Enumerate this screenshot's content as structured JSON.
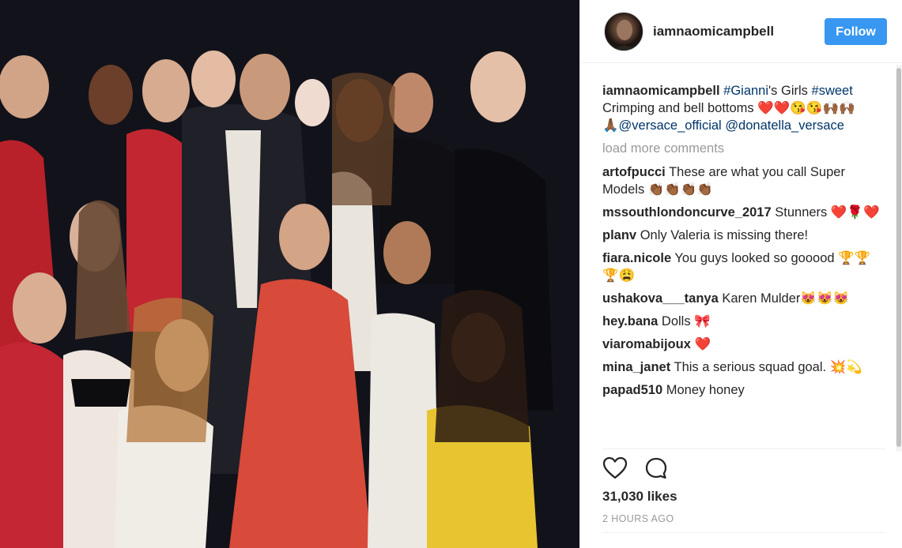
{
  "post": {
    "photo_alt": "Group photo",
    "author": "iamnaomicampbell",
    "follow_label": "Follow",
    "caption": {
      "username": "iamnaomicampbell",
      "hashtag1": "#Gianni",
      "after_hashtag1": "'s Girls ",
      "hashtag2": "#sweet",
      "line2": "Crimping and bell bottoms ❤️❤️😘😘🙌🏾🙌🏾",
      "emoji3": "🙏🏾",
      "mention1": "@versace_official",
      "mention2": "@donatella_versace"
    },
    "load_more": "load more comments",
    "comments": [
      {
        "username": "artofpucci",
        "text": "These are what you call Super Models 👏🏾👏🏾👏🏾👏🏾"
      },
      {
        "username": "mssouthlondoncurve_2017",
        "text": "Stunners ❤️🌹❤️"
      },
      {
        "username": "planv",
        "text": "Only Valeria is missing there!"
      },
      {
        "username": "fiara.nicole",
        "text": "You guys looked so gooood 🏆🏆🏆😩"
      },
      {
        "username": "ushakova___tanya",
        "text": "Karen Mulder😻😻😻"
      },
      {
        "username": "hey.bana",
        "text": "Dolls 🎀"
      },
      {
        "username": "viaromabijoux",
        "text": "❤️"
      },
      {
        "username": "mina_janet",
        "text": "This a serious squad goal. 💥💫"
      },
      {
        "username": "papad510",
        "text": "Money honey"
      }
    ],
    "likes": "31,030 likes",
    "timestamp": "2 HOURS AGO",
    "icons": {
      "like": "heart-icon",
      "comment": "comment-bubble-icon"
    },
    "colors": {
      "follow": "#3897f0",
      "link": "#003569",
      "muted": "#999999"
    }
  }
}
